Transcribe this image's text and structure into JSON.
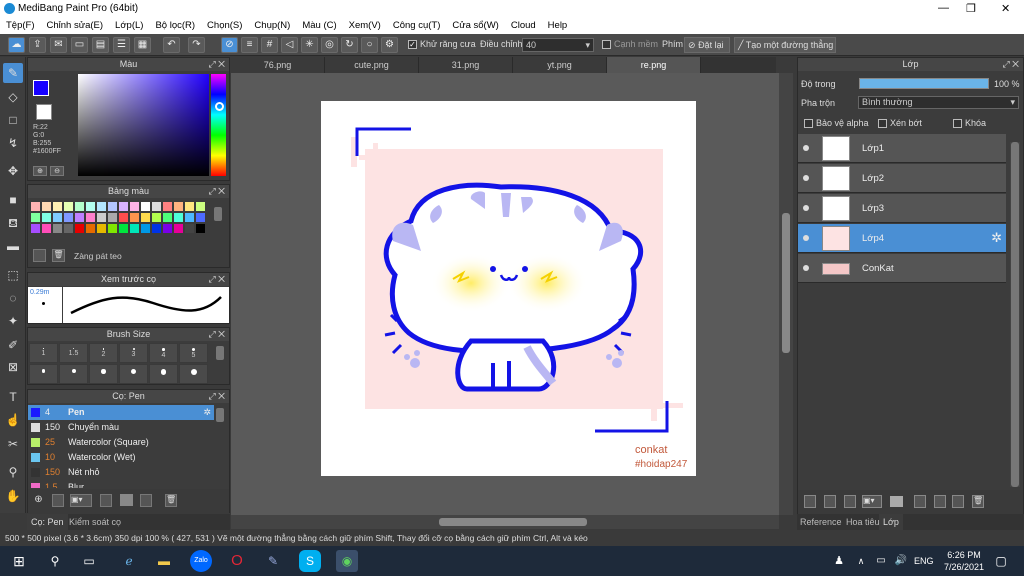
{
  "app": {
    "title": "MediBang Paint Pro (64bit)"
  },
  "menu": [
    "Tệp(F)",
    "Chỉnh sửa(E)",
    "Lớp(L)",
    "Bộ lọc(R)",
    "Chọn(S)",
    "Chụp(N)",
    "Màu (C)",
    "Xem(V)",
    "Công cụ(T)",
    "Cửa sổ(W)",
    "Cloud",
    "Help"
  ],
  "toolbar": {
    "antialias": "Khử răng cưa",
    "adjust_label": "Điều chỉnh",
    "adjust_value": "40",
    "overflow": "Cạnh mềm",
    "brush_label": "Phím",
    "reset": "Đặt lại",
    "create_line": "Tạo một đường thẳng"
  },
  "tabs": [
    "76.png",
    "cute.png",
    "31.png",
    "yt.png",
    "re.png"
  ],
  "color_panel": {
    "title": "Màu",
    "r": "R:22",
    "g": "G:0",
    "b": "B:255",
    "hex": "#1600FF"
  },
  "palette_panel": {
    "title": "Bảng màu",
    "name": "Zàng pát teo"
  },
  "preview_panel": {
    "title": "Xem trước cọ",
    "size": "0.29m"
  },
  "brushsize_panel": {
    "title": "Brush Size",
    "sizes": [
      "1",
      "1.5",
      "2",
      "3",
      "4",
      "5"
    ]
  },
  "brush_panel": {
    "title": "Cọ: Pen",
    "items": [
      {
        "size": "4",
        "name": "Pen",
        "color": "#1a1aff"
      },
      {
        "size": "150",
        "name": "Chuyển màu",
        "color": "#dddddd"
      },
      {
        "size": "25",
        "name": "Watercolor (Square)",
        "color": "#b9f06a"
      },
      {
        "size": "10",
        "name": "Watercolor (Wet)",
        "color": "#6ac6f0"
      },
      {
        "size": "150",
        "name": "Nét nhỏ",
        "color": "#333333"
      },
      {
        "size": "1.5",
        "name": "Blur",
        "color": "#f06ac6"
      }
    ]
  },
  "left_tabs": [
    "Cọ: Pen",
    "Kiểm soát cọ"
  ],
  "layer_panel": {
    "title": "Lớp",
    "opacity_label": "Độ trong",
    "opacity_value": "100 %",
    "blend_label": "Pha trộn",
    "blend_value": "Bình thường",
    "protect_alpha": "Bảo vệ alpha",
    "clipping": "Xén bớt",
    "lock": "Khóa",
    "layers": [
      "Lớp1",
      "Lớp2",
      "Lớp3",
      "Lớp4",
      "ConKat"
    ]
  },
  "right_tabs": [
    "Reference",
    "Hoa tiêu",
    "Lớp"
  ],
  "canvas_text": {
    "sig1": "conkat",
    "sig2": "#hoidap247"
  },
  "status": {
    "text": "500 * 500 pixel   (3.6 * 3.6cm)   350 dpi   100 %   ( 427, 531 )   Vẽ một đường thẳng bằng cách giữ phím Shift, Thay đổi cỡ cọ bằng cách giữ phím Ctrl, Alt và kéo"
  },
  "taskbar": {
    "lang": "ENG",
    "time": "6:26 PM",
    "date": "7/26/2021"
  }
}
